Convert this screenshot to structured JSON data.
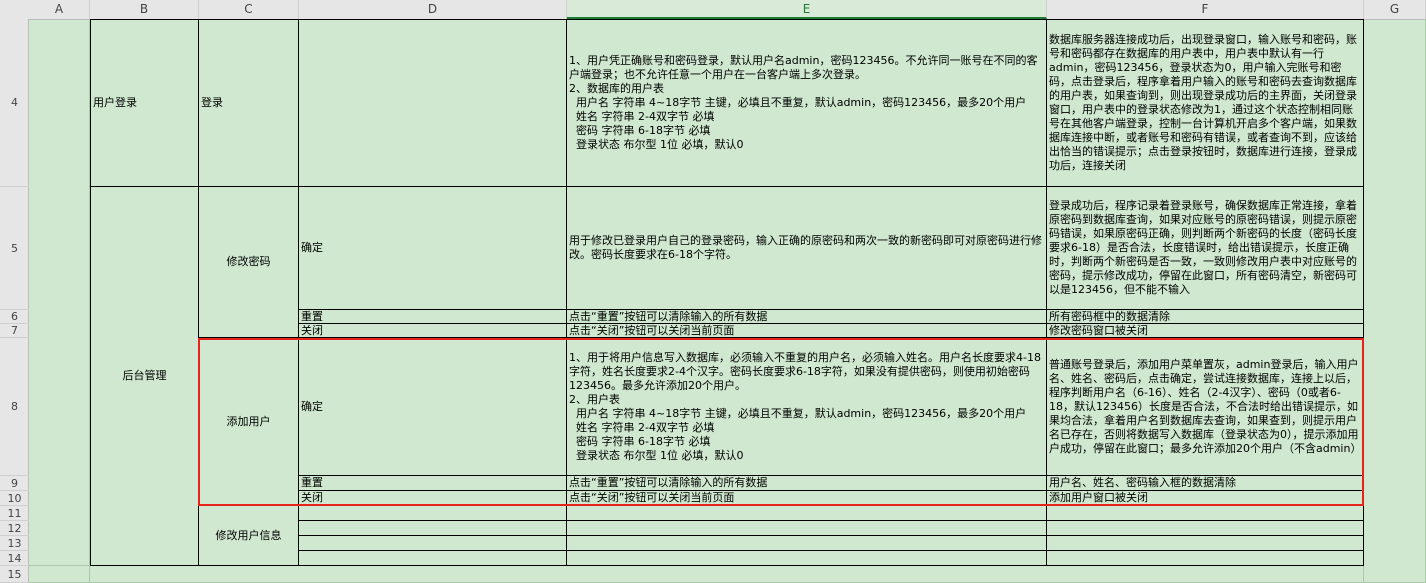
{
  "columns": [
    "A",
    "B",
    "C",
    "D",
    "E",
    "F",
    "G"
  ],
  "selected_column": "E",
  "rows": [
    "4",
    "5",
    "6",
    "7",
    "8",
    "9",
    "10",
    "11",
    "12",
    "13",
    "14",
    "15"
  ],
  "b_user_login": "用户登录",
  "b_admin": "后台管理",
  "c_login": "登录",
  "c_change_pwd": "修改密码",
  "c_add_user": "添加用户",
  "c_modify_user": "修改用户信息",
  "d_confirm": "确定",
  "d_reset": "重置",
  "d_close": "关闭",
  "e_row4": "1、用户凭正确账号和密码登录，默认用户名admin，密码123456。不允许同一账号在不同的客户端登录；也不允许任意一个用户在一台客户端上多次登录。\n2、数据库的用户表\n  用户名 字符串 4~18字节 主键，必填且不重复，默认admin，密码123456，最多20个用户\n  姓名 字符串 2-4双字节 必填\n  密码 字符串 6-18字节 必填\n  登录状态 布尔型 1位 必填，默认0",
  "f_row4": "数据库服务器连接成功后，出现登录窗口，输入账号和密码，账号和密码都存在数据库的用户表中，用户表中默认有一行admin，密码123456，登录状态为0，用户输入完账号和密码，点击登录后，程序拿着用户输入的账号和密码去查询数据库的用户表，如果查询到，则出现登录成功后的主界面，关闭登录窗口，用户表中的登录状态修改为1，通过这个状态控制相同账号在其他客户端登录，控制一台计算机开启多个客户端，如果数据库连接中断，或者账号和密码有错误，或者查询不到，应该给出恰当的错误提示；点击登录按钮时，数据库进行连接，登录成功后，连接关闭",
  "e_row5": "用于修改已登录用户自己的登录密码，输入正确的原密码和两次一致的新密码即可对原密码进行修改。密码长度要求在6-18个字符。",
  "f_row5": "登录成功后，程序记录着登录账号，确保数据库正常连接，拿着原密码到数据库查询，如果对应账号的原密码错误，则提示原密码错误，如果原密码正确，则判断两个新密码的长度（密码长度要求6-18）是否合法，长度错误时，给出错误提示，长度正确时，判断两个新密码是否一致，一致则修改用户表中对应账号的密码，提示修改成功，停留在此窗口，所有密码清空，新密码可以是123456，但不能不输入",
  "e_row6": "点击“重置”按钮可以清除输入的所有数据",
  "f_row6": "所有密码框中的数据清除",
  "e_row7": "点击“关闭”按钮可以关闭当前页面",
  "f_row7": "修改密码窗口被关闭",
  "e_row8": "1、用于将用户信息写入数据库，必须输入不重复的用户名，必须输入姓名。用户名长度要求4-18字符，姓名长度要求2-4个汉字。密码长度要求6-18字符，如果没有提供密码，则使用初始密码123456。最多允许添加20个用户。\n2、用户表\n  用户名 字符串 4~18字节 主键，必填且不重复，默认admin，密码123456，最多20个用户\n  姓名 字符串 2-4双字节 必填\n  密码 字符串 6-18字节 必填\n  登录状态 布尔型 1位 必填，默认0",
  "f_row8": "普通账号登录后，添加用户菜单置灰，admin登录后，输入用户名、姓名、密码后，点击确定，尝试连接数据库，连接上以后，程序判断用户名（6-16）、姓名（2-4汉字）、密码（0或者6-18，默认123456）长度是否合法，不合法时给出错误提示，如果均合法，拿着用户名到数据库去查询，如果查到，则提示用户名已存在，否则将数据写入数据库（登录状态为0），提示添加用户成功，停留在此窗口；最多允许添加20个用户（不含admin）",
  "e_row9": "点击“重置”按钮可以清除输入的所有数据",
  "f_row9": "用户名、姓名、密码输入框的数据清除",
  "e_row10": "点击“关闭”按钮可以关闭当前页面",
  "f_row10": "添加用户窗口被关闭",
  "colors": {
    "cell_bg": "#cfe8cf",
    "header_bg": "#e6e6e6",
    "selected_header": "#1e7b34",
    "highlight_box": "#e8231b"
  }
}
